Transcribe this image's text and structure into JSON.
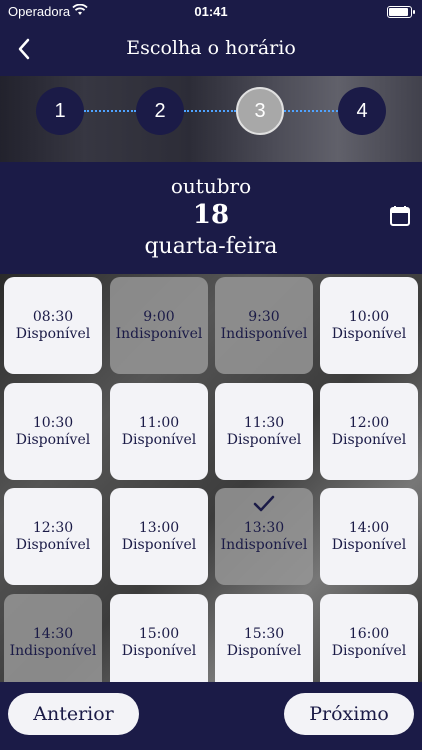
{
  "status_bar": {
    "carrier": "Operadora",
    "time": "01:41"
  },
  "nav": {
    "title": "Escolha o horário"
  },
  "stepper": {
    "steps": [
      "1",
      "2",
      "3",
      "4"
    ],
    "active_step": 3
  },
  "date": {
    "month": "outubro",
    "day": "18",
    "weekday": "quarta-feira"
  },
  "slots": [
    {
      "time": "08:30",
      "status": "Disponível",
      "available": true
    },
    {
      "time": "9:00",
      "status": "Indisponível",
      "available": false
    },
    {
      "time": "9:30",
      "status": "Indisponível",
      "available": false
    },
    {
      "time": "10:00",
      "status": "Disponível",
      "available": true
    },
    {
      "time": "10:30",
      "status": "Disponível",
      "available": true
    },
    {
      "time": "11:00",
      "status": "Disponível",
      "available": true
    },
    {
      "time": "11:30",
      "status": "Disponível",
      "available": true
    },
    {
      "time": "12:00",
      "status": "Disponível",
      "available": true
    },
    {
      "time": "12:30",
      "status": "Disponível",
      "available": true
    },
    {
      "time": "13:00",
      "status": "Disponível",
      "available": true
    },
    {
      "time": "13:30",
      "status": "Indisponível",
      "available": false,
      "selected": true
    },
    {
      "time": "14:00",
      "status": "Disponível",
      "available": true
    },
    {
      "time": "14:30",
      "status": "Indisponível",
      "available": false
    },
    {
      "time": "15:00",
      "status": "Disponível",
      "available": true
    },
    {
      "time": "15:30",
      "status": "Disponível",
      "available": true
    },
    {
      "time": "16:00",
      "status": "Disponível",
      "available": true
    }
  ],
  "footer": {
    "prev_label": "Anterior",
    "next_label": "Próximo"
  },
  "colors": {
    "primary": "#1b1b47",
    "card": "#f3f3f7",
    "unavailable": "#969696",
    "step_connector": "#4fa3ff"
  }
}
